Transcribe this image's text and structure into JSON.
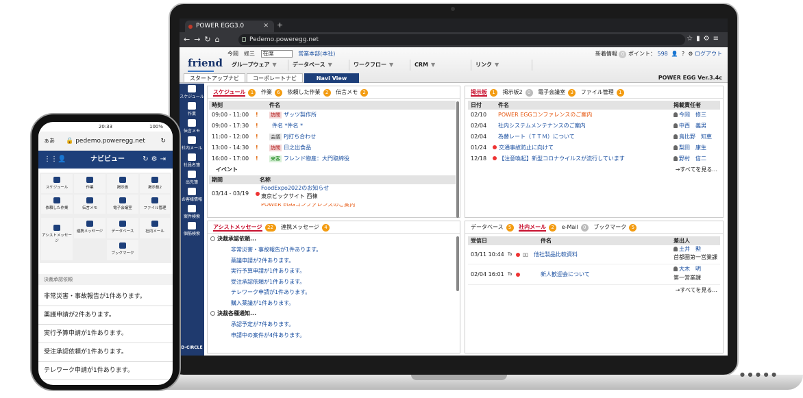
{
  "browser": {
    "tab_title": "POWER EGG3.0",
    "url": "Pedemo.poweregg.net"
  },
  "app": {
    "logo": "friend",
    "user_name": "今岡　修三",
    "status": "在席",
    "department": "営業本部(本社)",
    "new_info_label": "新着情報",
    "new_info_count": "0",
    "points_label": "ポイント：",
    "points_value": "598",
    "logout": "ログアウト",
    "version": "POWER EGG Ver.3.4c",
    "menus": [
      "グループウェア",
      "データベース",
      "ワークフロー",
      "CRM",
      "リンク"
    ],
    "navtabs": [
      "スタートアップナビ",
      "コーポレートナビ",
      "Navi View"
    ]
  },
  "sidebar": [
    "スケジュール",
    "作業",
    "伝言メモ",
    "社内メール",
    "社員名簿",
    "出先簿",
    "お客様情報",
    "案件検索",
    "個筋検索"
  ],
  "sidebar_logo": "D-CIRCLE",
  "schedule_panel": {
    "tabs": [
      {
        "label": "スケジュール",
        "count": "1"
      },
      {
        "label": "作業",
        "count": "6"
      },
      {
        "label": "依頼した作業",
        "count": "2"
      },
      {
        "label": "伝言メモ",
        "count": "2"
      }
    ],
    "col_time": "時刻",
    "col_subject": "件名",
    "rows": [
      {
        "time": "09:00 - 11:00",
        "tag": "訪問",
        "subject": "ザッツ製作所"
      },
      {
        "time": "09:00 - 17:30",
        "tag": "",
        "subject": "件名 *件名 *"
      },
      {
        "time": "11:00 - 12:00",
        "tag": "会議",
        "subject": "PJ打ち合わせ"
      },
      {
        "time": "13:00 - 14:30",
        "tag": "訪問",
        "subject": "日之出食品"
      },
      {
        "time": "16:00 - 17:00",
        "tag": "来客",
        "subject": "フレンド物産：大門取締役"
      }
    ],
    "event_label": "イベント",
    "col_period": "期間",
    "col_name": "名称",
    "event_period": "03/14 - 03/19",
    "event_name": "FoodExpo2022のお知らせ",
    "event_place": "東京ビックサイト 西棟",
    "event_next": "POWER EGGコンファレンスのご案内"
  },
  "board_panel": {
    "tabs": [
      {
        "label": "掲示板",
        "count": "1"
      },
      {
        "label": "掲示板2",
        "count": "0"
      },
      {
        "label": "電子会議室",
        "count": "3"
      },
      {
        "label": "ファイル管理",
        "count": "1"
      }
    ],
    "col_date": "日付",
    "col_subject": "件名",
    "col_owner": "掲載責任者",
    "rows": [
      {
        "date": "02/10",
        "subject": "POWER EGGコンファレンスのご案内",
        "owner": "今岡　修三"
      },
      {
        "date": "02/04",
        "subject": "社内システムメンテナンスのご案内",
        "owner": "中西　義男"
      },
      {
        "date": "02/04",
        "subject": "為替レート（ＴＴＭ）について",
        "owner": "鳥比野　知恵"
      },
      {
        "date": "01/24",
        "subject": "交通事故防止に向けて",
        "owner": "梨田　康生"
      },
      {
        "date": "12/18",
        "subject": "【注意喚起】新型コロナウイルスが流行しています",
        "owner": "野村　信二"
      }
    ],
    "see_all": "→すべてを見る..."
  },
  "assist_panel": {
    "tabs": [
      {
        "label": "アシストメッセージ",
        "count": "22"
      },
      {
        "label": "連携メッセージ",
        "count": "4"
      }
    ],
    "section1": "決裁承認依頼...",
    "items1": [
      "非常災害・事故報告が1件あります。",
      "薬議申請が2件あります。",
      "実行予算申請が1件あります。",
      "受注承認依頼が1件あります。",
      "テレワーク申請が1件あります。",
      "購入薬議が1件あります。"
    ],
    "section2": "決裁各種通知...",
    "items2": [
      "承認予定が7件あります。",
      "申請中の案件が4件あります。"
    ]
  },
  "mail_panel": {
    "tabs": [
      {
        "label": "データベース",
        "count": "5"
      },
      {
        "label": "社内メール",
        "count": "2"
      },
      {
        "label": "e-Mail",
        "count": "0"
      },
      {
        "label": "ブックマーク",
        "count": "5"
      }
    ],
    "col_date": "受信日",
    "col_subject": "件名",
    "col_from": "差出人",
    "rows": [
      {
        "date": "03/11 10:44",
        "to": "To",
        "subject": "他社製品比較資料",
        "from": "土井　勲",
        "from_dept": "首都圏第一営業課"
      },
      {
        "date": "02/04 16:01",
        "to": "To",
        "subject": "新人歓迎会について",
        "from": "大木　明",
        "from_dept": "第一営業課"
      }
    ],
    "see_all": "→すべてを見る..."
  },
  "phone": {
    "time": "20:33",
    "battery": "100%",
    "aa": "ぁあ",
    "url": "pedemo.poweregg.net",
    "nav_title": "ナビビュー",
    "grid": [
      "スケジュール",
      "作業",
      "掲示板",
      "掲示板2",
      "依頼した作業",
      "伝言メモ",
      "電子会議室",
      "ファイル管理",
      "アシストメッセージ",
      "連携メッセージ",
      "データベース",
      "社内メール",
      "ブックマーク"
    ],
    "list_header": "決裁承認依頼",
    "list": [
      "非常災害・事故報告が1件あります。",
      "薬議申請が2件あります。",
      "実行予算申請が1件あります。",
      "受注承認依頼が1件あります。",
      "テレワーク申請が1件あります。"
    ]
  }
}
